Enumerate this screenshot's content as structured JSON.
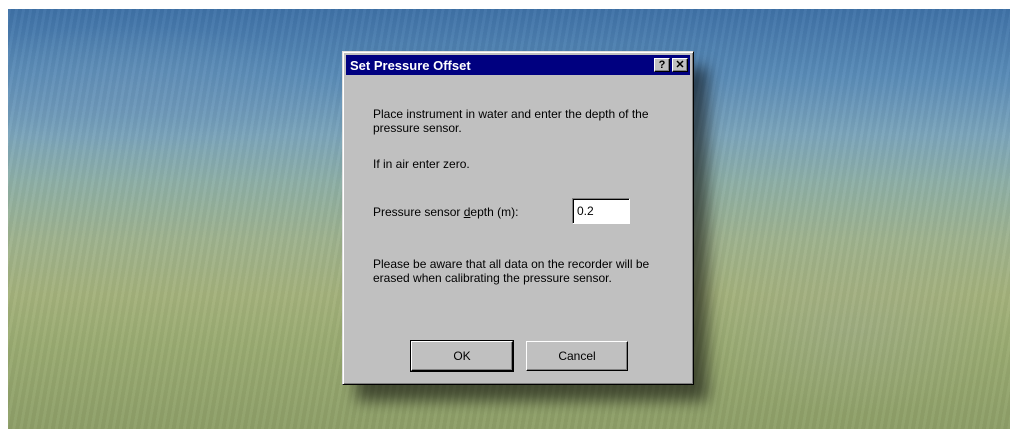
{
  "dialog": {
    "title": "Set Pressure Offset",
    "help_label": "?",
    "close_label": "✕",
    "instruction_text": "Place instrument in water and enter the depth of the pressure sensor.",
    "air_text": "If in air enter zero.",
    "depth_label_before": "Pressure sensor ",
    "depth_label_access": "d",
    "depth_label_after": "epth (m):",
    "depth_value": "0.2",
    "warning_text": "Please be aware that all data on the recorder will be erased when calibrating the pressure sensor.",
    "ok_label": "OK",
    "cancel_label": "Cancel"
  }
}
